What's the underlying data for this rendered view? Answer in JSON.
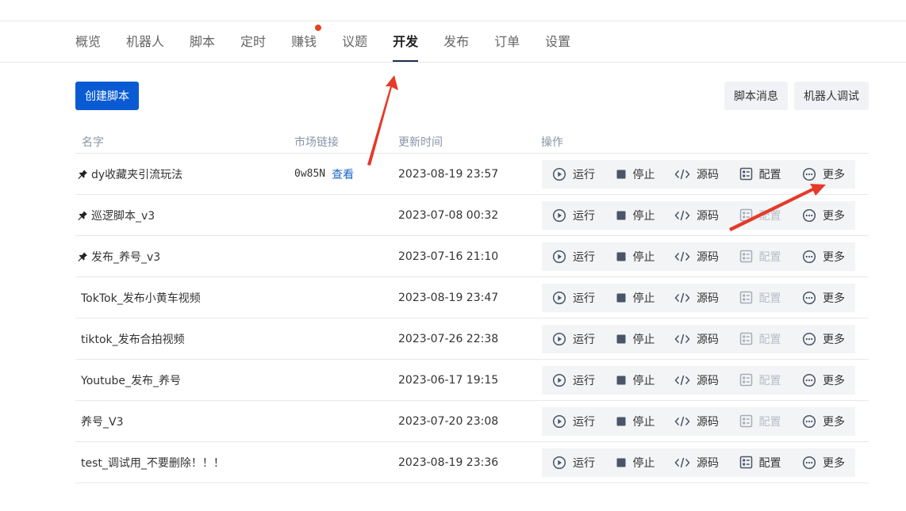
{
  "colors": {
    "primary": "#0a5bd3",
    "notice_dot": "#e0461f",
    "arrow": "#e53a2a"
  },
  "tabs": [
    {
      "label": "概览"
    },
    {
      "label": "机器人"
    },
    {
      "label": "脚本"
    },
    {
      "label": "定时"
    },
    {
      "label": "赚钱",
      "dot": true
    },
    {
      "label": "议题"
    },
    {
      "label": "开发",
      "active": true
    },
    {
      "label": "发布"
    },
    {
      "label": "订单"
    },
    {
      "label": "设置"
    }
  ],
  "toolbar": {
    "create_label": "创建脚本",
    "messages_label": "脚本消息",
    "debug_label": "机器人调试"
  },
  "table": {
    "headers": {
      "name": "名字",
      "link": "市场链接",
      "time": "更新时间",
      "ops": "操作"
    },
    "ops": {
      "run": "运行",
      "stop": "停止",
      "source": "源码",
      "config": "配置",
      "more": "更多"
    },
    "rows": [
      {
        "name": "dy收藏夹引流玩法",
        "pinned": true,
        "link_code": "0w85N",
        "link_view": "查看",
        "time": "2023-08-19 23:57",
        "config_enabled": true
      },
      {
        "name": "巡逻脚本_v3",
        "pinned": true,
        "link_code": "",
        "link_view": "",
        "time": "2023-07-08 00:32",
        "config_enabled": false
      },
      {
        "name": "发布_养号_v3",
        "pinned": true,
        "link_code": "",
        "link_view": "",
        "time": "2023-07-16 21:10",
        "config_enabled": false
      },
      {
        "name": "TokTok_发布小黄车视频",
        "pinned": false,
        "link_code": "",
        "link_view": "",
        "time": "2023-08-19 23:47",
        "config_enabled": false
      },
      {
        "name": "tiktok_发布合拍视频",
        "pinned": false,
        "link_code": "",
        "link_view": "",
        "time": "2023-07-26 22:38",
        "config_enabled": false
      },
      {
        "name": "Youtube_发布_养号",
        "pinned": false,
        "link_code": "",
        "link_view": "",
        "time": "2023-06-17 19:15",
        "config_enabled": false
      },
      {
        "name": "养号_V3",
        "pinned": false,
        "link_code": "",
        "link_view": "",
        "time": "2023-07-20 23:08",
        "config_enabled": false
      },
      {
        "name": "test_调试用_不要删除！！！",
        "pinned": false,
        "link_code": "",
        "link_view": "",
        "time": "2023-08-19 23:36",
        "config_enabled": true
      }
    ]
  }
}
